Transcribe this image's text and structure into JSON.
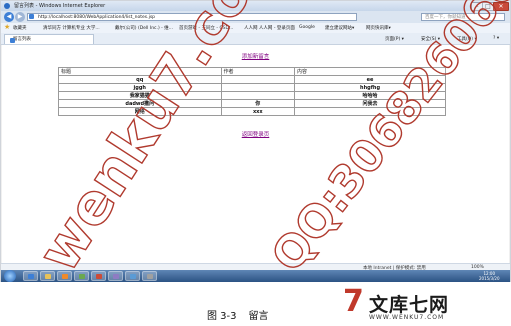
{
  "browser": {
    "title": "留言列表 - Windows Internet Explorer",
    "window_controls": {
      "minimize": "–",
      "maximize": "□",
      "close": "✕"
    },
    "nav": {
      "back_icon": "arrow-left-icon",
      "forward_icon": "arrow-right-icon"
    },
    "address": "http://localhost:8080/WebApplication4/list_notes.jsp",
    "search_placeholder": "百度一下，你就知道",
    "favorites_label": "收藏夹",
    "favorites": [
      "清华同方 计算机专业 大学...",
      "戴尔(公司) (Dell Inc.) - 维...",
      "首页游戏 - 王同立 - CSD...",
      "人人网 人人网 - 登录页面",
      "Google",
      "建立建议网站▾",
      "网页快讯库▾"
    ],
    "tab_label": "留言列表",
    "commands": {
      "page": "页面(P) ▾",
      "safety": "安全(S) ▾",
      "tools": "工具(O) ▾",
      "help": "? ▾"
    }
  },
  "page": {
    "add_link": "添加新留言",
    "table": {
      "headers": [
        "标题",
        "作者",
        "内容"
      ],
      "rows": [
        [
          "qq",
          "",
          "ee"
        ],
        [
          "jggh",
          "",
          "hhgfhg"
        ],
        [
          "我家猫猫",
          "",
          "哈哈哈"
        ],
        [
          "dadwd撒问",
          "你",
          "问我去"
        ],
        [
          "网络",
          "xxx",
          ""
        ]
      ]
    },
    "home_link": "返回登录页"
  },
  "statusbar": {
    "text": "本地 Intranet | 保护模式: 禁用",
    "zoom": "100%"
  },
  "taskbar": {
    "clock_time": "12:00",
    "clock_date": "2015/3/20"
  },
  "watermark": {
    "site": "wenku7.com",
    "qq": "QQ:306826066"
  },
  "caption": {
    "figure": "图 3-3",
    "title": "留言"
  },
  "logo": {
    "mark": "7",
    "name": "文库七网",
    "url": "WWW.WENKU7.COM"
  },
  "colors": {
    "link_visited": "#800080",
    "watermark": "#b03a2e",
    "logo_red": "#c0392b"
  }
}
